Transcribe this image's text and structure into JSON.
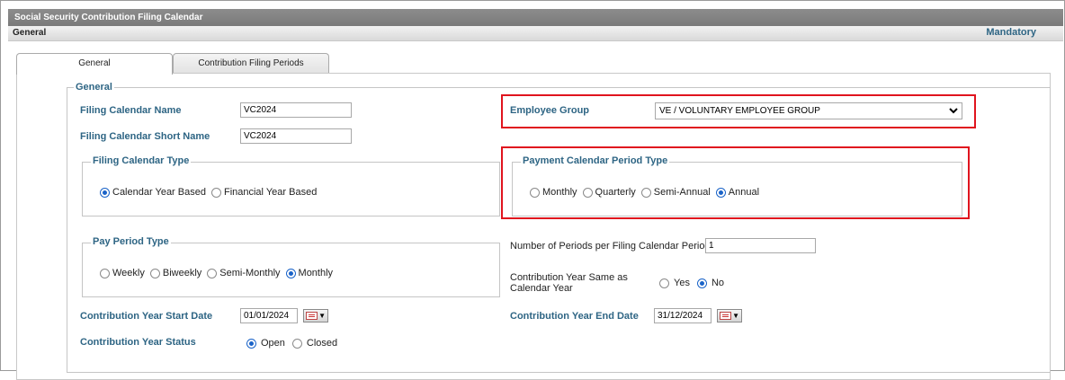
{
  "window": {
    "title": "Social Security Contribution Filing Calendar"
  },
  "section": {
    "label": "General",
    "mandatory": "Mandatory"
  },
  "tabs": [
    {
      "label": "General"
    },
    {
      "label": "Contribution Filing Periods"
    }
  ],
  "general": {
    "legend": "General",
    "filing_calendar_name": {
      "label": "Filing Calendar Name",
      "value": "VC2024"
    },
    "filing_calendar_short_name": {
      "label": "Filing Calendar Short Name",
      "value": "VC2024"
    },
    "employee_group": {
      "label": "Employee Group",
      "value": "VE / VOLUNTARY EMPLOYEE GROUP"
    },
    "filing_calendar_type": {
      "legend": "Filing Calendar Type",
      "options": [
        "Calendar Year Based",
        "Financial Year Based"
      ],
      "selected": "Calendar Year Based"
    },
    "payment_calendar_period_type": {
      "legend": "Payment Calendar Period Type",
      "options": [
        "Monthly",
        "Quarterly",
        "Semi-Annual",
        "Annual"
      ],
      "selected": "Annual"
    },
    "pay_period_type": {
      "legend": "Pay Period Type",
      "options": [
        "Weekly",
        "Biweekly",
        "Semi-Monthly",
        "Monthly"
      ],
      "selected": "Monthly"
    },
    "number_of_periods": {
      "label": "Number of Periods per Filing Calendar Period",
      "value": "1"
    },
    "contribution_year_same": {
      "label_line1": "Contribution Year Same as",
      "label_line2": "Calendar Year",
      "options": [
        "Yes",
        "No"
      ],
      "selected": "No"
    },
    "contribution_year_start_date": {
      "label": "Contribution Year Start Date",
      "value": "01/01/2024"
    },
    "contribution_year_end_date": {
      "label": "Contribution Year End Date",
      "value": "31/12/2024"
    },
    "contribution_year_status": {
      "label": "Contribution Year Status",
      "options": [
        "Open",
        "Closed"
      ],
      "selected": "Open"
    }
  },
  "icons": {
    "dropdown": "chevron-down-icon",
    "calendar": "calendar-icon"
  },
  "colors": {
    "label": "#2e6584",
    "highlight": "#e0141e",
    "radio_selected": "#1a63c8",
    "titlebar": "#808080"
  }
}
